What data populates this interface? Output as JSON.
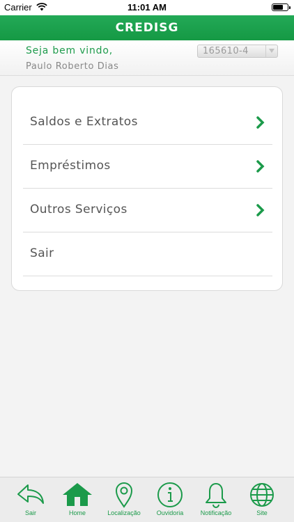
{
  "status_bar": {
    "carrier": "Carrier",
    "time": "11:01 AM"
  },
  "header": {
    "title": "CREDISG"
  },
  "welcome": {
    "greeting": "Seja bem vindo,",
    "user_name": "Paulo Roberto Dias",
    "account": "165610-4"
  },
  "menu": {
    "items": [
      {
        "label": "Saldos e Extratos",
        "has_chevron": true
      },
      {
        "label": "Empréstimos",
        "has_chevron": true
      },
      {
        "label": "Outros Serviços",
        "has_chevron": true
      },
      {
        "label": "Sair",
        "has_chevron": false
      }
    ]
  },
  "tabbar": {
    "tabs": [
      {
        "label": "Sair",
        "icon": "back-arrow-icon"
      },
      {
        "label": "Home",
        "icon": "home-icon"
      },
      {
        "label": "Localização",
        "icon": "location-pin-icon"
      },
      {
        "label": "Ouvidoria",
        "icon": "info-icon"
      },
      {
        "label": "Notificação",
        "icon": "bell-icon"
      },
      {
        "label": "Site",
        "icon": "globe-icon"
      }
    ]
  },
  "colors": {
    "brand_green": "#1b9a4a",
    "background": "#f3f3f3"
  }
}
